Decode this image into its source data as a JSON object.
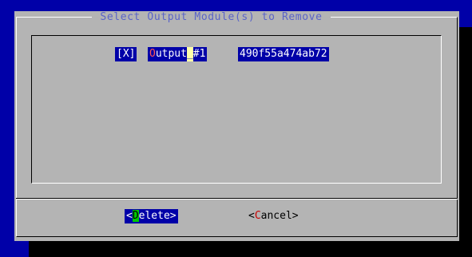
{
  "dialog": {
    "title": " Select Output Module(s) to Remove "
  },
  "list": {
    "items": [
      {
        "checkbox": "[X]",
        "name_hotkey": "O",
        "name_rest_a": "utput",
        "name_cursor": "_",
        "name_rest_b": "#1",
        "id": "490f55a474ab72"
      }
    ]
  },
  "buttons": {
    "delete": {
      "open": "<",
      "hotkey": "D",
      "rest": "elete>"
    },
    "cancel": {
      "open": "<",
      "hotkey": "C",
      "rest": "ancel>"
    }
  },
  "colors": {
    "screen_bg": "#0000a8",
    "dialog_bg": "#b4b4b4",
    "title_fg": "#5a64c8",
    "highlight_bg": "#0000a8",
    "hotkey_red": "#ff5555",
    "hotkey_green_bg": "#00c800"
  }
}
